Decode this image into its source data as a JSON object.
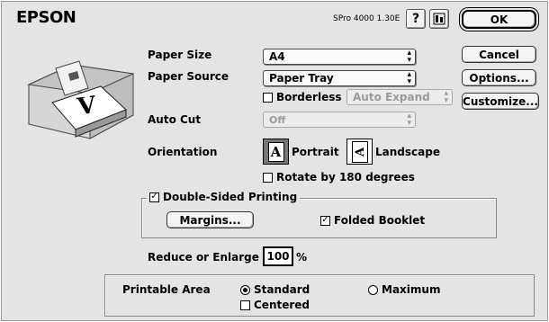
{
  "header": {
    "brand": "EPSON",
    "version": "SPro 4000 1.30E"
  },
  "buttons": {
    "ok": "OK",
    "cancel": "Cancel",
    "options": "Options...",
    "customize": "Customize..."
  },
  "labels": {
    "paper_size": "Paper Size",
    "paper_source": "Paper Source",
    "auto_cut": "Auto Cut",
    "orientation": "Orientation",
    "reduce_enlarge": "Reduce or Enlarge",
    "percent": "%",
    "printable_area": "Printable Area"
  },
  "paper_size": {
    "value": "A4"
  },
  "paper_source": {
    "value": "Paper Tray"
  },
  "borderless": {
    "label": "Borderless",
    "checked": false,
    "mode": "Auto Expand"
  },
  "auto_cut": {
    "value": "Off"
  },
  "orientation": {
    "portrait": "Portrait",
    "landscape": "Landscape",
    "selected": "portrait",
    "rotate_label": "Rotate by 180 degrees",
    "rotate_checked": false
  },
  "double_sided": {
    "label": "Double-Sided Printing",
    "checked": true,
    "margins_button": "Margins...",
    "folded_booklet": "Folded Booklet",
    "folded_checked": true
  },
  "scale": {
    "value": "100"
  },
  "printable_area": {
    "standard": "Standard",
    "maximum": "Maximum",
    "selected": "standard",
    "centered": "Centered",
    "centered_checked": false
  },
  "colors": {
    "dialog_bg": "#e4e4e4",
    "accent": "#000000"
  }
}
